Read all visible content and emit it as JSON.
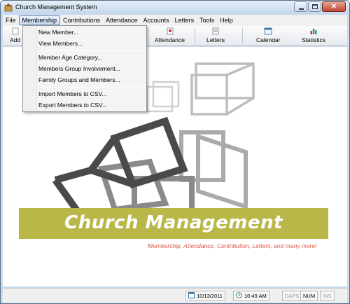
{
  "window": {
    "title": "Church Management System"
  },
  "menubar": {
    "items": [
      {
        "label": "File"
      },
      {
        "label": "Membership"
      },
      {
        "label": "Contributions"
      },
      {
        "label": "Attendance"
      },
      {
        "label": "Accounts"
      },
      {
        "label": "Letters"
      },
      {
        "label": "Tools"
      },
      {
        "label": "Help"
      }
    ]
  },
  "membership_menu": {
    "items": [
      "New Member...",
      "View Members...",
      "Member Age Category...",
      "Members Group Involvement...",
      "Family Groups and Members...",
      "Import Members to CSV...",
      "Export Members to CSV..."
    ]
  },
  "toolbar": {
    "add_label": "Add",
    "attendance_label": "Attendance",
    "letters_label": "Letters",
    "calendar_label": "Calendar",
    "statistics_label": "Statistics"
  },
  "banner": {
    "title": "Church Management",
    "tagline": "Membership, Attendance, Contribution, Letters, and many more!"
  },
  "statusbar": {
    "date": "10/13/2011",
    "time": "10:49 AM",
    "caps": "CAPS",
    "num": "NUM",
    "ins": "INS"
  },
  "colors": {
    "banner": "#b8b748",
    "tagline": "#e0564a",
    "cube_dark": "#444444",
    "cube_mid": "#888888",
    "cube_light": "#cccccc"
  }
}
